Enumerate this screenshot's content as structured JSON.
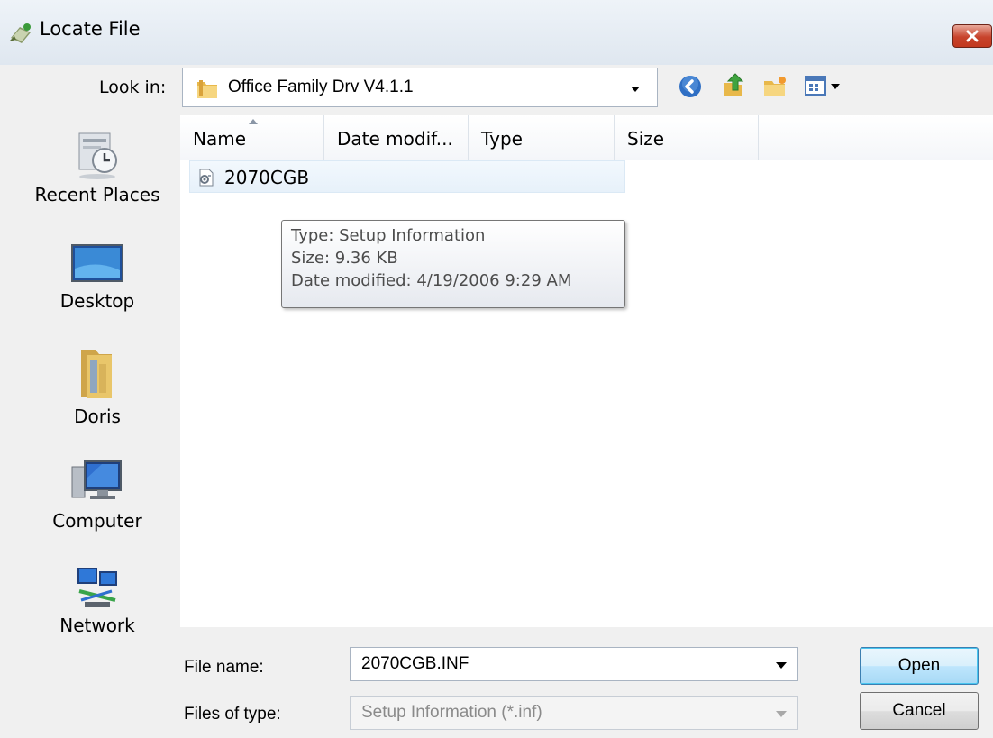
{
  "window": {
    "title": "Locate File"
  },
  "lookin": {
    "label": "Look in:",
    "value": "Office Family Drv V4.1.1"
  },
  "toolbar_icons": [
    "back-icon",
    "up-folder-icon",
    "new-folder-icon",
    "views-menu-icon"
  ],
  "places": [
    {
      "label": "Recent Places",
      "icon": "recent-places-icon"
    },
    {
      "label": "Desktop",
      "icon": "desktop-icon"
    },
    {
      "label": "Doris",
      "icon": "user-folder-icon"
    },
    {
      "label": "Computer",
      "icon": "computer-icon"
    },
    {
      "label": "Network",
      "icon": "network-icon"
    }
  ],
  "columns": [
    "Name",
    "Date modif...",
    "Type",
    "Size"
  ],
  "files": [
    {
      "name": "2070CGB",
      "icon": "setup-information-file-icon"
    }
  ],
  "tooltip": {
    "type": "Type: Setup Information",
    "size": "Size: 9.36 KB",
    "date": "Date modified: 4/19/2006 9:29 AM"
  },
  "filename": {
    "label": "File name:",
    "value": "2070CGB.INF"
  },
  "filetype": {
    "label": "Files of type:",
    "value": "Setup Information (*.inf)"
  },
  "buttons": {
    "open": "Open",
    "cancel": "Cancel"
  },
  "colors": {
    "close_button": "#c7432c",
    "selection": "#e7f1fa",
    "default_button": "#bee6fd"
  }
}
